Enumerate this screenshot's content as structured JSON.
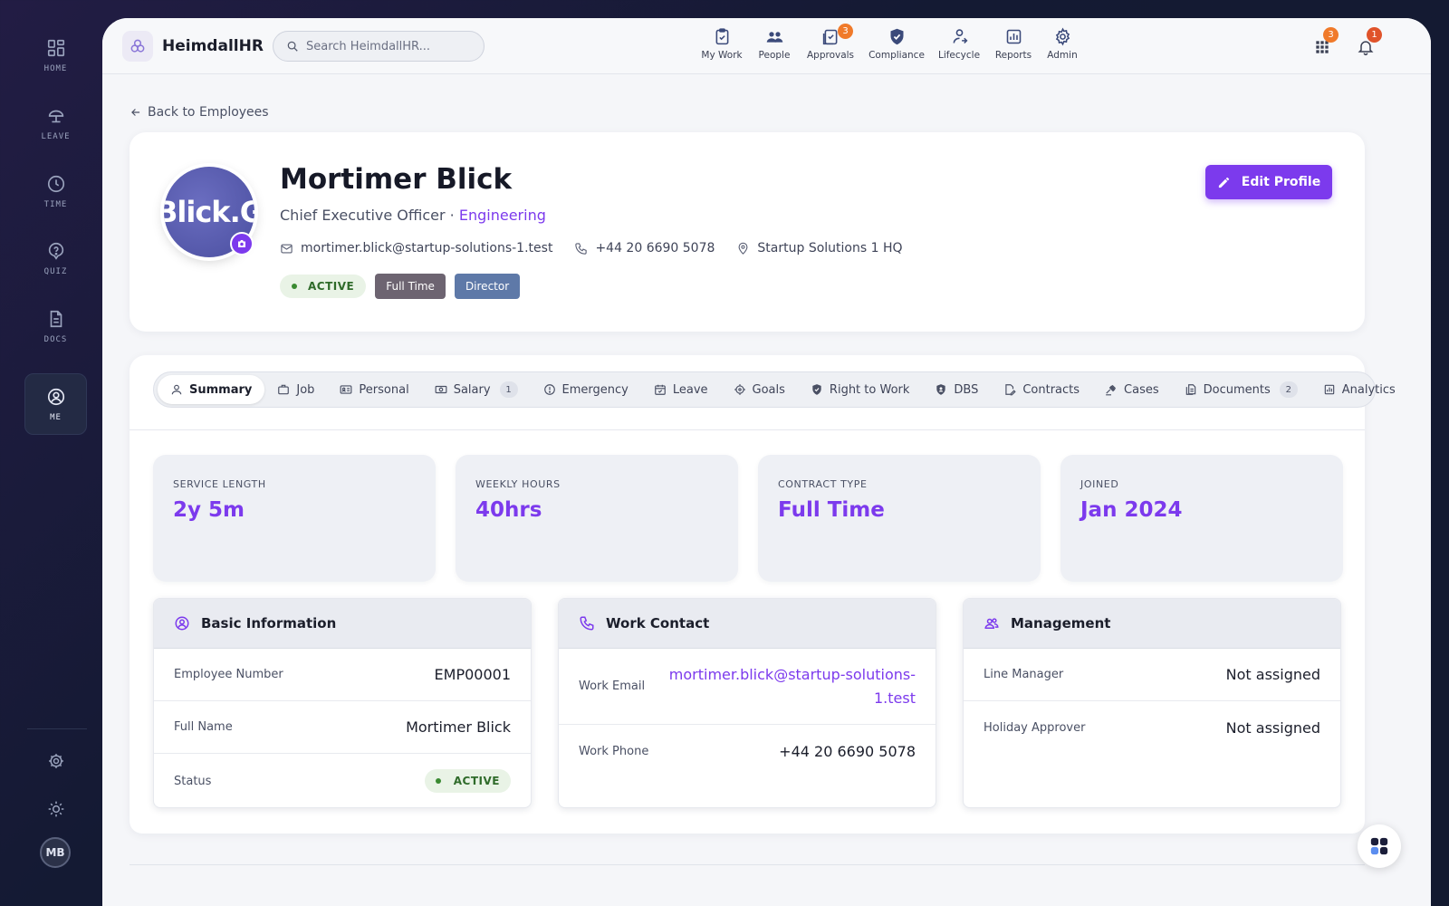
{
  "sidebar": {
    "items": [
      {
        "label": "HOME",
        "icon": "grid-icon"
      },
      {
        "label": "LEAVE",
        "icon": "umbrella-icon"
      },
      {
        "label": "TIME",
        "icon": "clock-icon"
      },
      {
        "label": "QUIZ",
        "icon": "question-icon"
      },
      {
        "label": "DOCS",
        "icon": "document-icon"
      },
      {
        "label": "ME",
        "icon": "user-circle-icon",
        "active": true
      }
    ],
    "avatar_initials": "MB"
  },
  "topbar": {
    "brand": "HeimdallHR",
    "search_placeholder": "Search HeimdallHR...",
    "nav": [
      {
        "label": "My Work",
        "icon": "clipboard-icon"
      },
      {
        "label": "People",
        "icon": "people-icon"
      },
      {
        "label": "Approvals",
        "icon": "approvals-icon",
        "badge": "3"
      },
      {
        "label": "Compliance",
        "icon": "shield-icon"
      },
      {
        "label": "Lifecycle",
        "icon": "lifecycle-icon"
      },
      {
        "label": "Reports",
        "icon": "chart-icon"
      },
      {
        "label": "Admin",
        "icon": "gear-icon"
      }
    ],
    "apps_badge": "3",
    "notifications_badge": "1"
  },
  "back_label": "Back to Employees",
  "profile": {
    "avatar_text": "Blick.G",
    "name": "Mortimer Blick",
    "title": "Chief Executive Officer",
    "separator": " · ",
    "department": "Engineering",
    "email": "mortimer.blick@startup-solutions-1.test",
    "phone": "+44 20 6690 5078",
    "location": "Startup Solutions 1 HQ",
    "status": "ACTIVE",
    "tags": [
      {
        "label": "Full Time",
        "color": "#6d6471"
      },
      {
        "label": "Director",
        "color": "#5e79a8"
      }
    ],
    "edit_label": "Edit Profile"
  },
  "tabs": [
    {
      "label": "Summary",
      "icon": "user-icon",
      "active": true
    },
    {
      "label": "Job",
      "icon": "briefcase-icon"
    },
    {
      "label": "Personal",
      "icon": "id-card-icon"
    },
    {
      "label": "Salary",
      "icon": "cash-icon",
      "count": "1"
    },
    {
      "label": "Emergency",
      "icon": "alert-icon"
    },
    {
      "label": "Leave",
      "icon": "calendar-icon"
    },
    {
      "label": "Goals",
      "icon": "target-icon"
    },
    {
      "label": "Right to Work",
      "icon": "shield-check-icon"
    },
    {
      "label": "DBS",
      "icon": "badge-icon"
    },
    {
      "label": "Contracts",
      "icon": "contract-icon"
    },
    {
      "label": "Cases",
      "icon": "gavel-icon"
    },
    {
      "label": "Documents",
      "icon": "files-icon",
      "count": "2"
    },
    {
      "label": "Analytics",
      "icon": "analytics-icon"
    }
  ],
  "stats": [
    {
      "label": "SERVICE LENGTH",
      "value": "2y 5m"
    },
    {
      "label": "WEEKLY HOURS",
      "value": "40hrs"
    },
    {
      "label": "CONTRACT TYPE",
      "value": "Full Time"
    },
    {
      "label": "JOINED",
      "value": "Jan 2024"
    }
  ],
  "basic_info": {
    "title": "Basic Information",
    "rows": [
      {
        "key": "Employee Number",
        "value": "EMP00001"
      },
      {
        "key": "Full Name",
        "value": "Mortimer Blick"
      },
      {
        "key": "Status",
        "value": "ACTIVE"
      }
    ]
  },
  "work_contact": {
    "title": "Work Contact",
    "email_label": "Work Email",
    "email_line1": "mortimer.blick@startup-solutions-",
    "email_line2": "1.test",
    "phone_label": "Work Phone",
    "phone": "+44 20 6690 5078"
  },
  "management": {
    "title": "Management",
    "rows": [
      {
        "key": "Line Manager",
        "value": "Not assigned"
      },
      {
        "key": "Holiday Approver",
        "value": "Not assigned"
      }
    ]
  },
  "colors": {
    "accent": "#7c3aed",
    "active_green": "#2f6b2a"
  }
}
